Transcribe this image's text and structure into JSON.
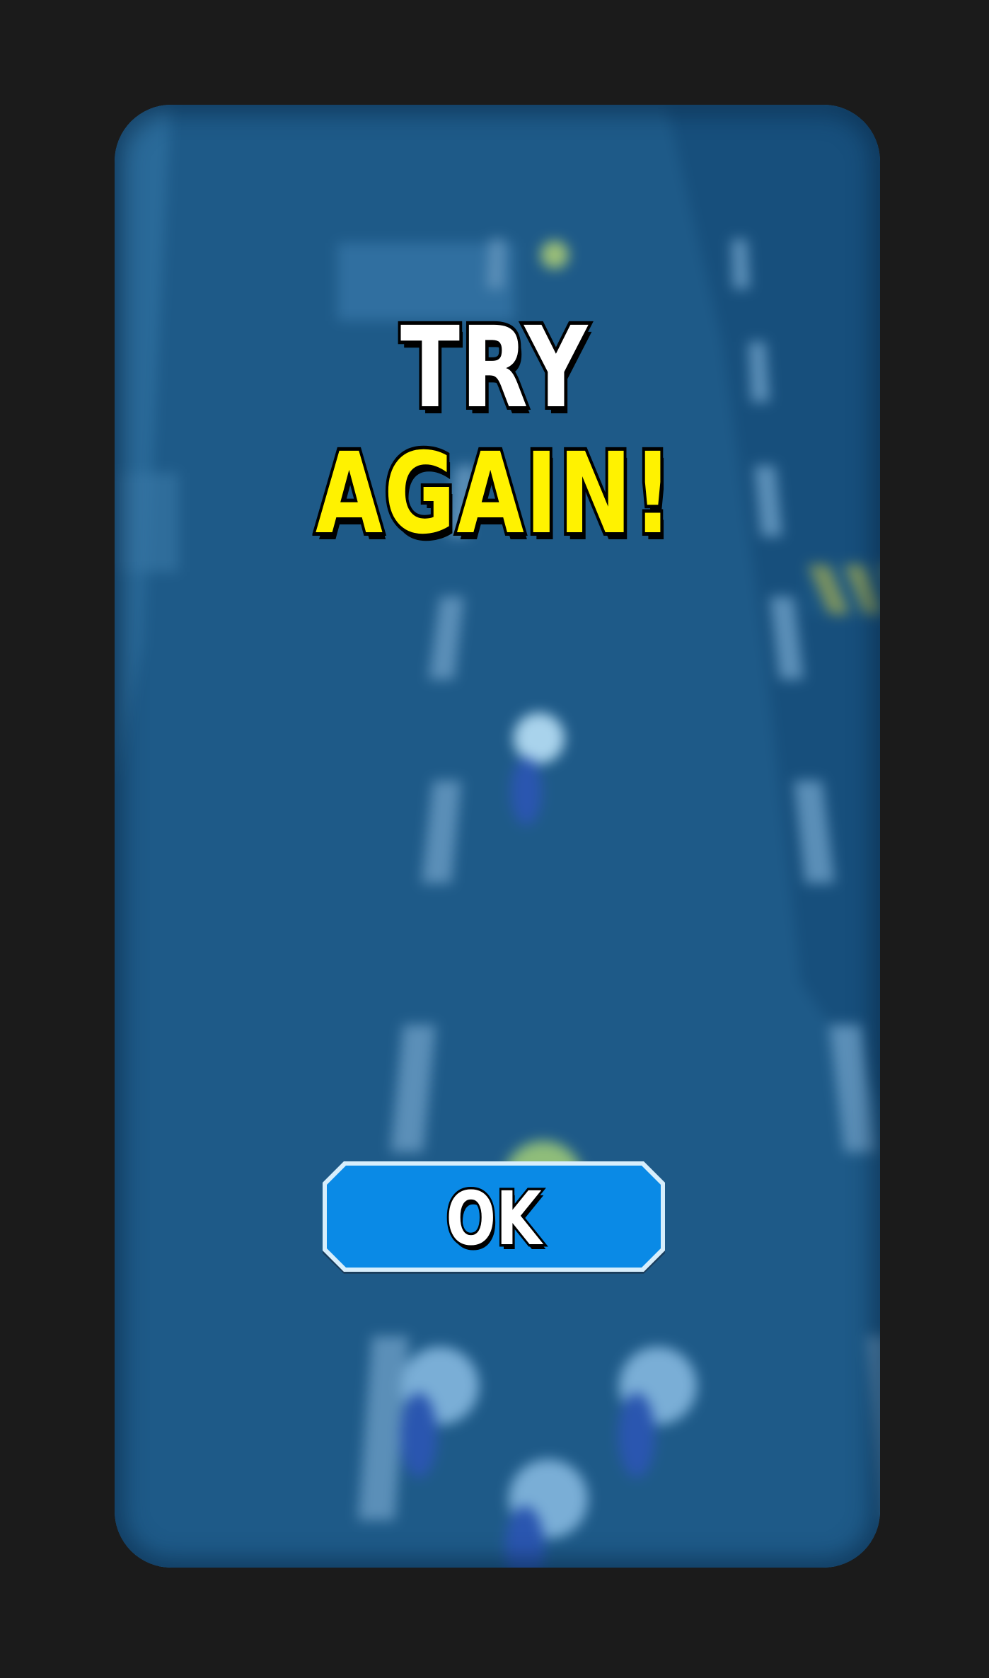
{
  "screen": "game-over-overlay",
  "headline": {
    "line1": "TRY",
    "line2": "AGAIN!"
  },
  "ok_button": {
    "label": "OK"
  },
  "colors": {
    "outer_background": "#1b1b1b",
    "road": "#1e5a88",
    "lane_marking": "#5b8fb8",
    "headline_line1": "#ffffff",
    "headline_line2": "#fff200",
    "text_outline": "#000000",
    "button_fill": "#0a8ae6",
    "button_border": "#d7eefc",
    "button_shadow": "#1a3d5c"
  }
}
